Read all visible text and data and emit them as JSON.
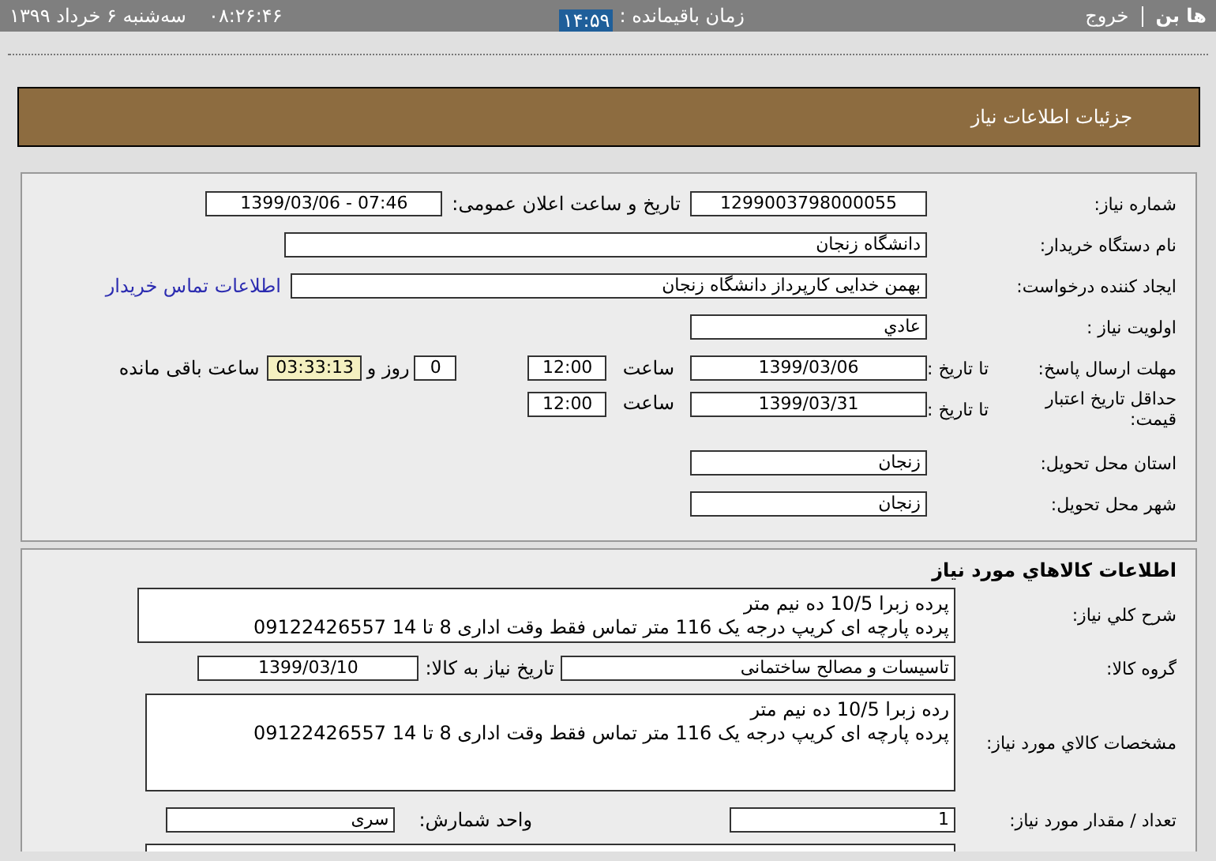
{
  "top_bar": {
    "brand": "ها بن",
    "logout": "خروج",
    "remaining_label": "زمان باقیمانده :",
    "remaining_time": "۱۴:۵۹",
    "clock": "۰۸:۲۶:۴۶",
    "date": "سه‌شنبه ۶ خرداد ۱۳۹۹"
  },
  "page_title": "جزئیات اطلاعات نیاز",
  "need_details": {
    "need_number": {
      "label": "شماره نیاز:",
      "value": "1299003798000055",
      "announce_label": "تاریخ و ساعت اعلان عمومی:",
      "announce_value": "1399/03/06 - 07:46"
    },
    "buyer": {
      "label": "نام دستگاه خریدار:",
      "value": "دانشگاه زنجان"
    },
    "requester": {
      "label": "ایجاد کننده درخواست:",
      "value": "بهمن خدایی کارپرداز دانشگاه زنجان",
      "link": "اطلاعات تماس خریدار"
    },
    "priority": {
      "label": "اولویت نیاز :",
      "value": "عادي"
    },
    "deadline": {
      "label": "مهلت ارسال پاسخ:",
      "to_date_label": "تا تاریخ :",
      "date": "1399/03/06",
      "time_label": "ساعت",
      "time": "12:00",
      "days": "0",
      "days_label": "روز و",
      "remaining": "03:33:13",
      "remaining_label": "ساعت باقی مانده"
    },
    "price_validity": {
      "label": "حداقل تاریخ اعتبار قیمت:",
      "to_date_label": "تا تاریخ :",
      "date": "1399/03/31",
      "time_label": "ساعت",
      "time": "12:00"
    },
    "province": {
      "label": "استان محل تحویل:",
      "value": "زنجان"
    },
    "city": {
      "label": "شهر محل تحویل:",
      "value": "زنجان"
    }
  },
  "goods": {
    "title": "اطلاعات کالاهاي مورد نياز",
    "summary": {
      "label": "شرح کلي نياز:",
      "lines": [
        "پرده زبرا 10/5 ده نیم متر",
        "پرده پارچه ای کریپ درجه یک 116 متر  تماس فقط وقت اداری 8 تا 14 09122426557"
      ]
    },
    "group": {
      "label": "گروه کالا:",
      "value": "تاسیسات و مصالح ساختمانی",
      "need_date_label": "تاریخ نیاز به کالا:",
      "need_date": "1399/03/10"
    },
    "specs": {
      "label": "مشخصات کالاي مورد نياز:",
      "lines": [
        "رده زبرا 10/5 ده نیم متر",
        "پرده پارچه ای کریپ درجه یک 116 متر  تماس فقط وقت اداری 8 تا 14 09122426557"
      ]
    },
    "quantity": {
      "label": "تعداد / مقدار مورد نیاز:",
      "value": "1",
      "unit_label": "واحد شمارش:",
      "unit": "سری"
    }
  }
}
